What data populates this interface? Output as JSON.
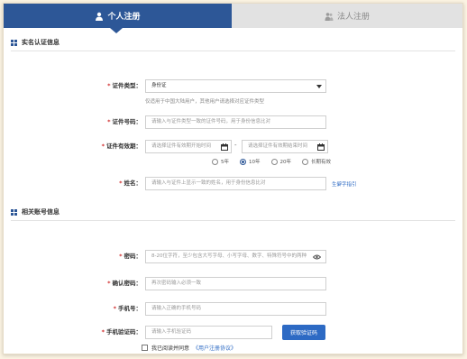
{
  "tabs": {
    "personal": "个人注册",
    "legal": "法人注册"
  },
  "sections": {
    "identity": "实名认证信息",
    "account": "相关账号信息"
  },
  "identity": {
    "id_type": {
      "label": "证件类型：",
      "value": "身份证",
      "hint": "仅适用于中国大陆用户，其他用户请选择对应证件类型"
    },
    "id_number": {
      "label": "证件号码：",
      "placeholder": "请输入与证件类型一致的证件号码，用于身份信息比对"
    },
    "validity": {
      "label": "证件有效期：",
      "start_placeholder": "请选择证件有效期开始时间",
      "separator": "-",
      "end_placeholder": "请选择证件有效期结束时间",
      "options": [
        "5年",
        "10年",
        "20年",
        "长期有效"
      ],
      "selected": "10年"
    },
    "name": {
      "label": "姓名：",
      "placeholder": "请输入与证件上显示一致的姓名，用于身份信息比对",
      "link": "生僻字指引"
    }
  },
  "account": {
    "password": {
      "label": "密码：",
      "placeholder": "8-20位字符，至少包含大写字母、小写字母、数字、特殊符号中的两种"
    },
    "confirm_password": {
      "label": "确认密码：",
      "placeholder": "再次密码输入必须一致"
    },
    "phone": {
      "label": "手机号：",
      "placeholder": "请输入正确的手机号码"
    },
    "sms_code": {
      "label": "手机验证码：",
      "placeholder": "请输入手机验证码",
      "button": "获取验证码"
    }
  },
  "agreement": {
    "text": "我已阅读并同意",
    "link": "《用户注册协议》"
  },
  "colors": {
    "primary": "#2d5797",
    "link": "#2d6ac4",
    "required": "#d02c2c"
  }
}
